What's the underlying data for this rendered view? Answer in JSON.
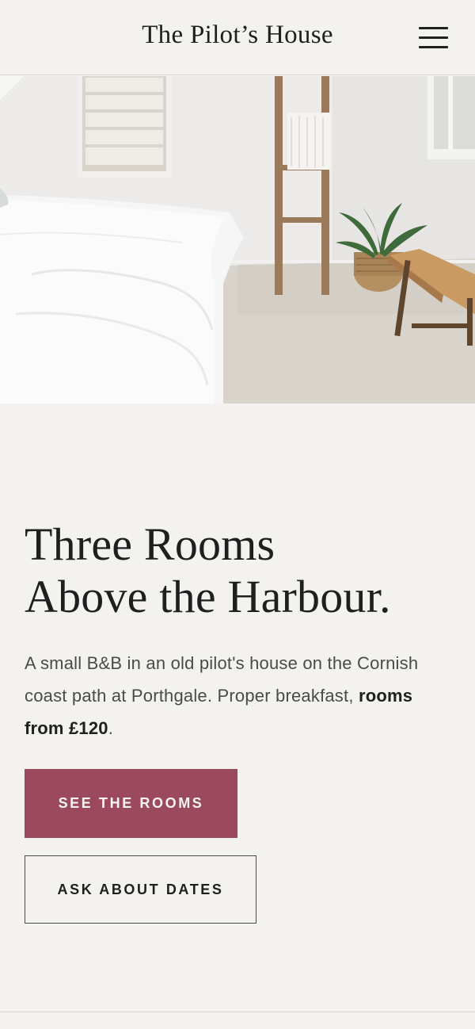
{
  "header": {
    "brand": "The Pilot’s House",
    "menu_icon": "hamburger-menu-icon"
  },
  "hero": {
    "image": "bedroom-photo"
  },
  "main": {
    "headline_line1": "Three Rooms",
    "headline_line2": "Above the Harbour.",
    "lede_text": "A small B&B in an old pilot's house on the Cornish coast path at Porthgale. Proper breakfast, ",
    "lede_emphasis": "rooms from £120",
    "lede_end": "."
  },
  "actions": {
    "primary_label": "SEE THE ROOMS",
    "secondary_label": "ASK ABOUT DATES"
  },
  "colors": {
    "background": "#f4f2ef",
    "accent": "#9a4a5c",
    "text": "#1f1f1f"
  }
}
